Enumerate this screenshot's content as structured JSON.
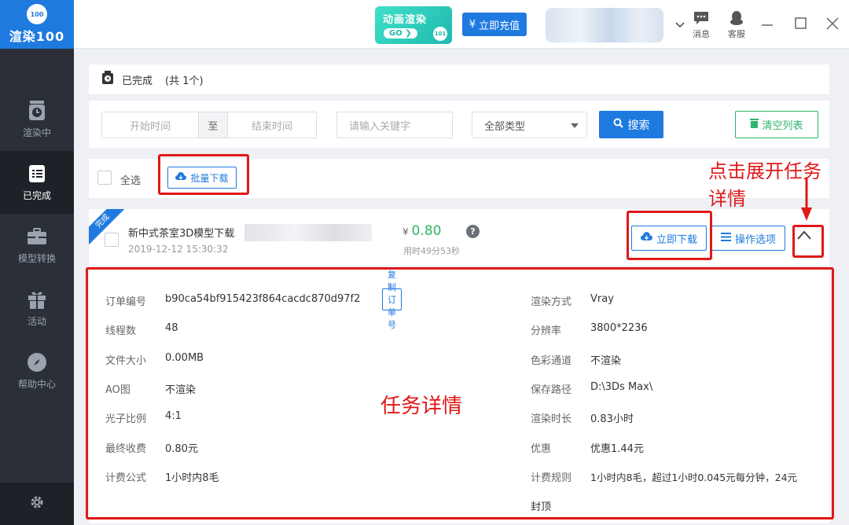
{
  "app": {
    "logo_text": "100",
    "name": "渲染100"
  },
  "sidebar": {
    "items": [
      {
        "label": "渲染中",
        "icon": "clock-icon",
        "active": false
      },
      {
        "label": "已完成",
        "icon": "list-icon",
        "active": true
      },
      {
        "label": "模型转换",
        "icon": "briefcase-icon",
        "active": false
      },
      {
        "label": "活动",
        "icon": "gift-icon",
        "active": false
      },
      {
        "label": "帮助中心",
        "icon": "compass-icon",
        "active": false
      }
    ],
    "settings_icon": "gear-icon"
  },
  "topbar": {
    "promo_title": "动画渲染",
    "promo_go": "GO",
    "promo_badge": "101",
    "recharge_symbol": "¥",
    "recharge_label": "立即充值",
    "messages_label": "消息",
    "service_label": "客服"
  },
  "header": {
    "title": "已完成",
    "count": "(共 1个)"
  },
  "filters": {
    "start_placeholder": "开始时间",
    "to_label": "至",
    "end_placeholder": "结束时间",
    "keyword_placeholder": "请输入关键字",
    "type_value": "全部类型",
    "search_label": "搜索",
    "clear_label": "清空列表"
  },
  "toolbar": {
    "select_all_label": "全选",
    "batch_download_label": "批量下载"
  },
  "task": {
    "status_ribbon": "完成",
    "name": "新中式茶室3D模型下载",
    "time": "2019-12-12 15:30:32",
    "price_symbol": "¥",
    "price": "0.80",
    "elapsed": "用时49分53秒",
    "help_mark": "?",
    "download_label": "立即下载",
    "options_label": "操作选项"
  },
  "details": {
    "copy_order_label": "复制订单号",
    "left": [
      {
        "key": "订单编号",
        "value": "b90ca54bf915423f864cacdc870d97f2"
      },
      {
        "key": "线程数",
        "value": "48"
      },
      {
        "key": "文件大小",
        "value": "0.00MB"
      },
      {
        "key": "AO图",
        "value": "不渲染"
      },
      {
        "key": "光子比例",
        "value": "4:1"
      },
      {
        "key": "最终收费",
        "value": "0.80元"
      },
      {
        "key": "计费公式",
        "value": "1小时内8毛"
      }
    ],
    "right": [
      {
        "key": "渲染方式",
        "value": "Vray"
      },
      {
        "key": "分辨率",
        "value": "3800*2236"
      },
      {
        "key": "色彩通道",
        "value": "不渲染"
      },
      {
        "key": "保存路径",
        "value": "D:\\3Ds Max\\"
      },
      {
        "key": "渲染时长",
        "value": "0.83小时"
      },
      {
        "key": "优惠",
        "value": "优惠1.44元"
      },
      {
        "key": "计费规则",
        "value": "1小时内8毛，超过1小时0.045元每分钟，24元"
      }
    ],
    "right_wrap": "封顶"
  },
  "annotations": {
    "expand_hint_line1": "点击展开任务",
    "expand_hint_line2": "详情",
    "details_label": "任务详情",
    "color": "#e01818"
  },
  "colors": {
    "brand": "#1f7ae0",
    "sidebar": "#2b3038",
    "price": "#31b46a",
    "clear": "#31b46a"
  }
}
